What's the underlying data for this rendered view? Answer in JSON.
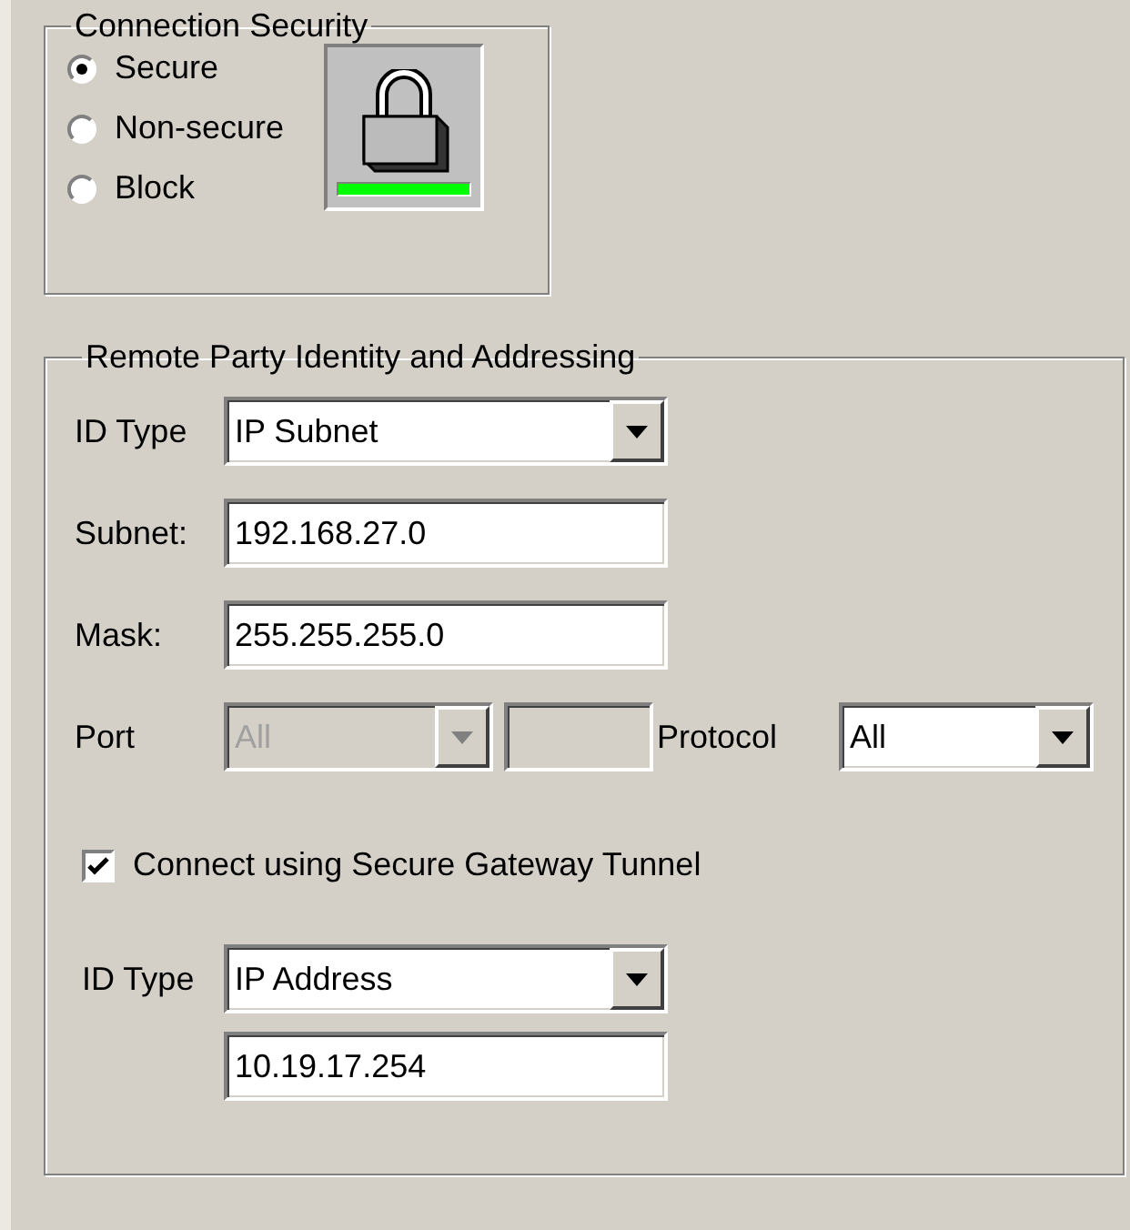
{
  "connection_security": {
    "legend": "Connection Security",
    "options": [
      {
        "label": "Secure",
        "selected": true
      },
      {
        "label": "Non-secure",
        "selected": false
      },
      {
        "label": "Block",
        "selected": false
      }
    ]
  },
  "remote_party": {
    "legend": "Remote Party Identity and Addressing",
    "id_type": {
      "label": "ID Type",
      "value": "IP Subnet"
    },
    "subnet": {
      "label": "Subnet:",
      "value": "192.168.27.0"
    },
    "mask": {
      "label": "Mask:",
      "value": "255.255.255.0"
    },
    "port": {
      "label": "Port",
      "value": "All",
      "disabled": true
    },
    "port_number": {
      "disabled": true
    },
    "protocol": {
      "label": "Protocol",
      "value": "All"
    },
    "tunnel": {
      "label": "Connect using Secure Gateway Tunnel",
      "checked": true
    },
    "gateway_id_type": {
      "label": "ID Type",
      "value": "IP Address"
    },
    "gateway_address": {
      "value": "10.19.17.254"
    }
  }
}
